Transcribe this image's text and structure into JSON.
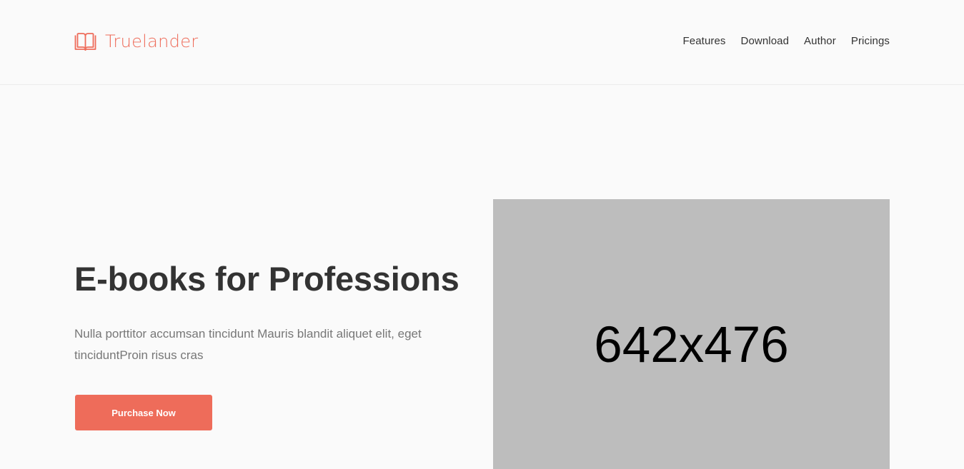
{
  "brand": {
    "name": "Truelander",
    "icon": "open-book-icon",
    "color": "#ee6c5a"
  },
  "nav": {
    "items": [
      "Features",
      "Download",
      "Author",
      "Pricings"
    ]
  },
  "hero": {
    "title": "E-books for Professions",
    "text": "Nulla porttitor accumsan tincidunt Mauris blandit aliquet elit, eget tinciduntProin risus cras",
    "button_label": "Purchase Now",
    "image_label": "642x476"
  },
  "colors": {
    "accent": "#ee6c5a",
    "heading": "#333333",
    "body_text": "#777777",
    "placeholder_bg": "#bdbdbd",
    "page_bg": "#fafafa"
  }
}
